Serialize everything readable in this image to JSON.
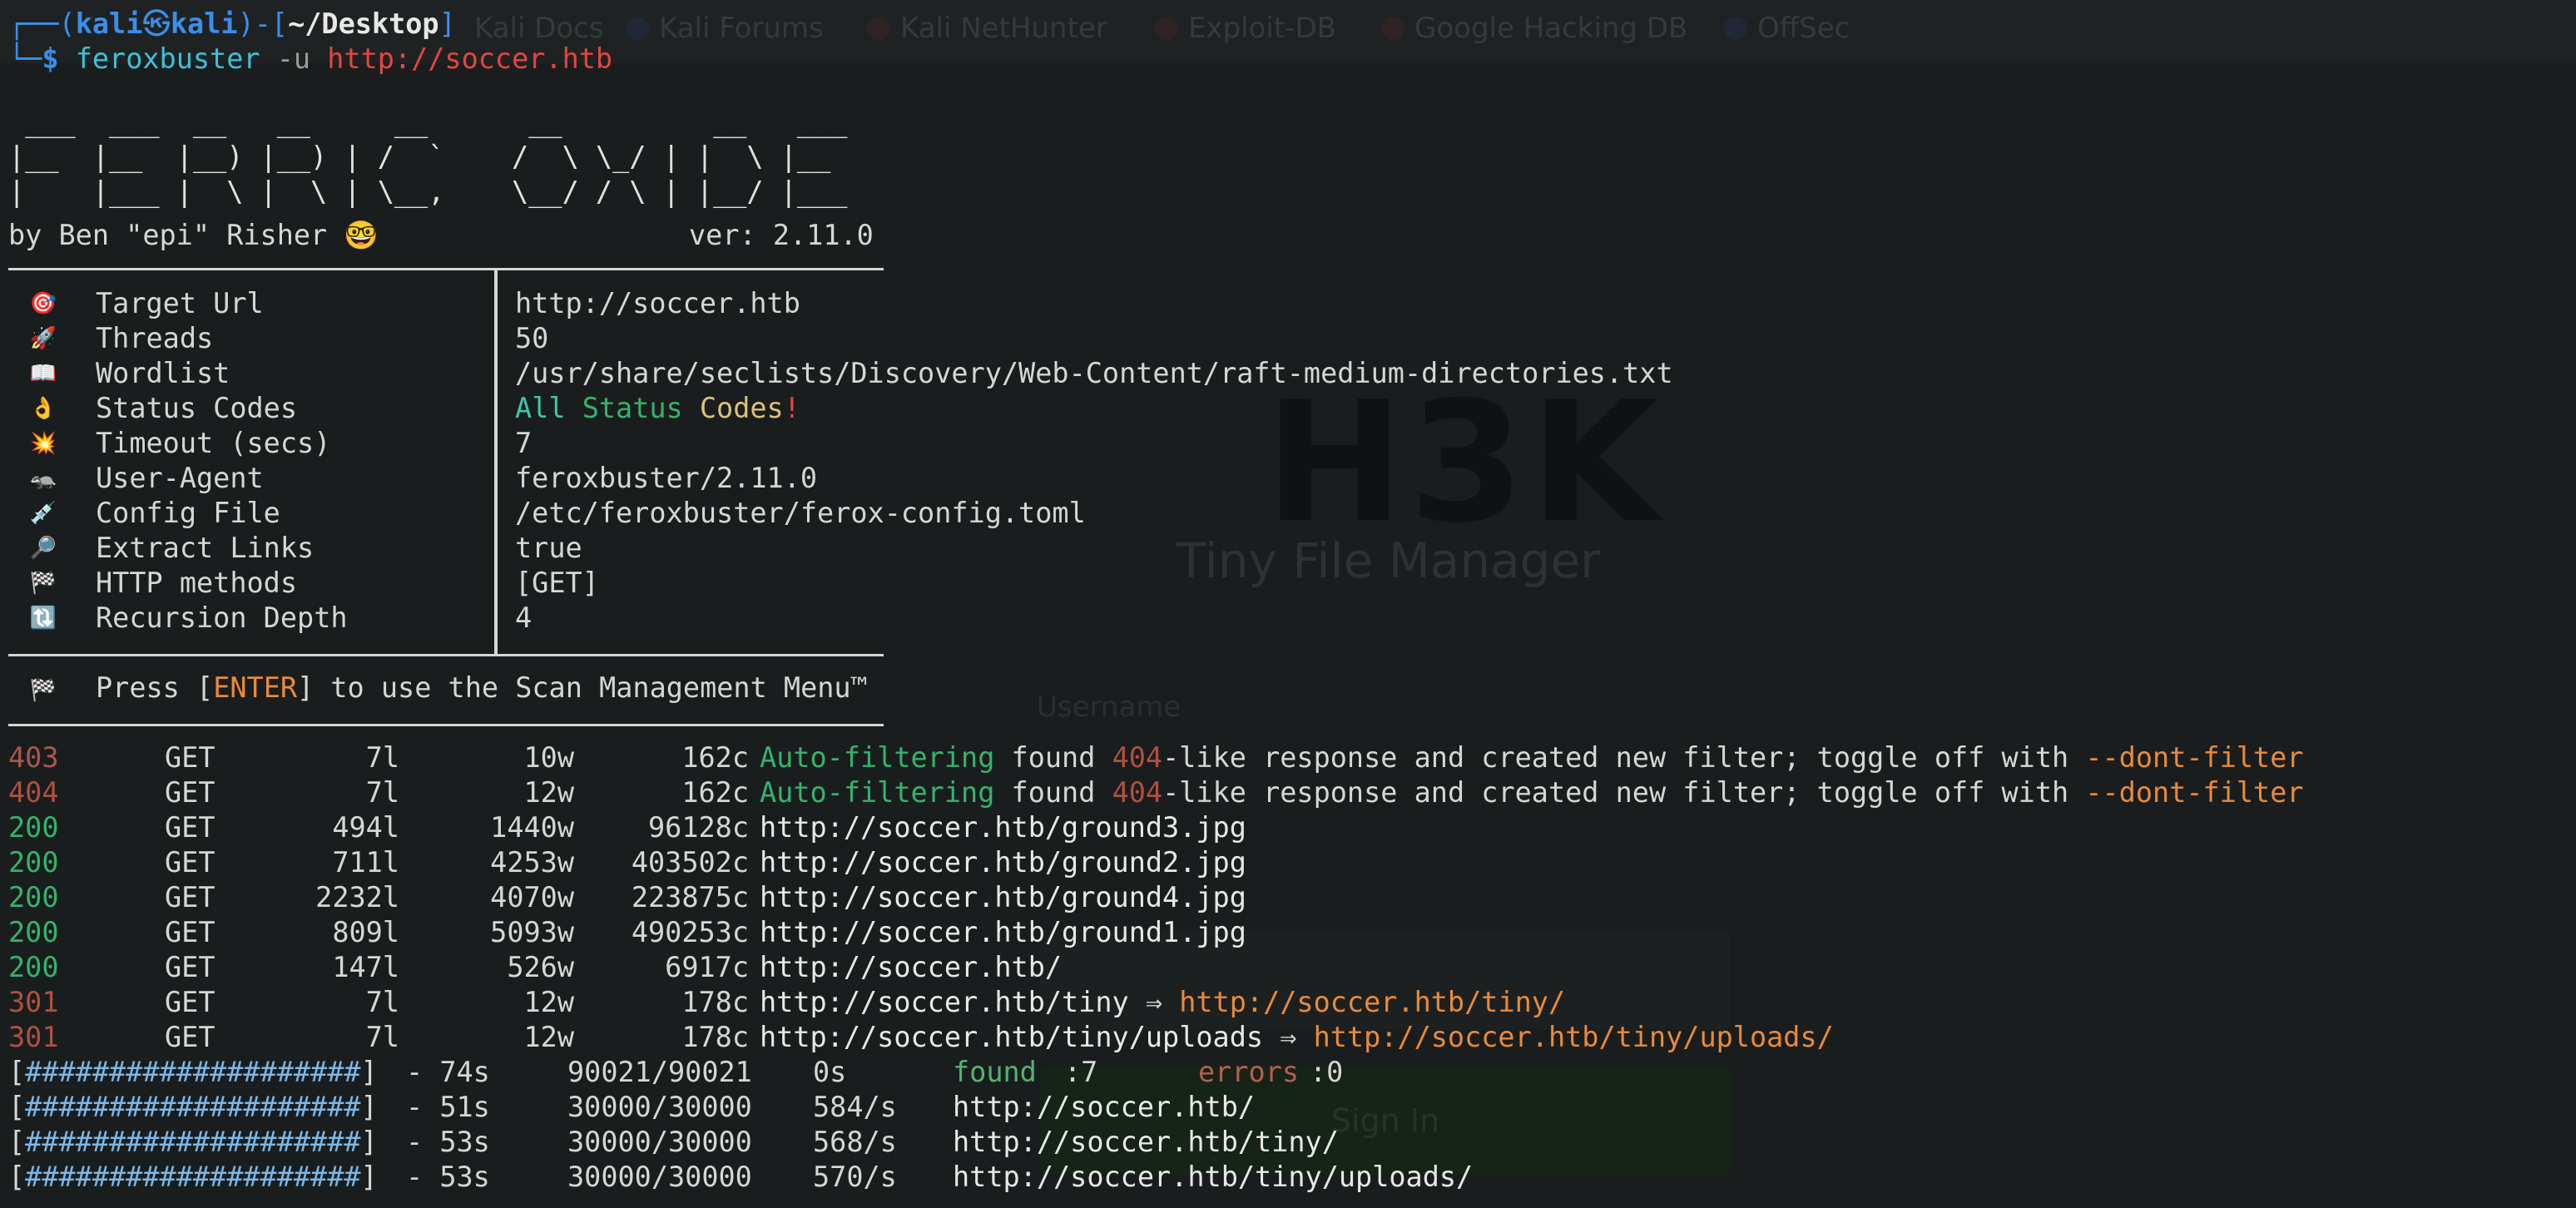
{
  "background": {
    "bookmarks": [
      {
        "label": "Kali Docs"
      },
      {
        "label": "Kali Forums"
      },
      {
        "label": "Kali NetHunter"
      },
      {
        "label": "Exploit-DB"
      },
      {
        "label": "Google Hacking DB"
      },
      {
        "label": "OffSec"
      }
    ],
    "page_logo": "H3K",
    "page_subtitle": "Tiny File Manager",
    "username_label": "Username",
    "sign_in_button": "Sign In"
  },
  "prompt": {
    "prefix_top": "┌──(",
    "user": "kali",
    "at": "㉿",
    "host": "kali",
    "mid": ")-[",
    "cwd": "~/Desktop",
    "close": "]",
    "prefix_bottom": "└─",
    "dollar": "$",
    "command": "feroxbuster",
    "flag": "-u",
    "url": "http://soccer.htb"
  },
  "banner": {
    "art": " ___  ___  __   __     __      __         __   ___\n|__  |__  |__) |__) | /  `    /  \\ \\_/ | |  \\ |__\n|    |___ |  \\ |  \\ | \\__,    \\__/ / \\ | |__/ |___",
    "author": "by Ben \"epi\" Risher 🤓",
    "version": "ver: 2.11.0"
  },
  "config": [
    {
      "icon": "🎯",
      "icon_name": "target-icon",
      "key": "Target Url",
      "value": "http://soccer.htb"
    },
    {
      "icon": "🚀",
      "icon_name": "rocket-icon",
      "key": "Threads",
      "value": "50"
    },
    {
      "icon": "📖",
      "icon_name": "book-icon",
      "key": "Wordlist",
      "value": "/usr/share/seclists/Discovery/Web-Content/raft-medium-directories.txt"
    },
    {
      "icon": "👌",
      "icon_name": "ok-hand-icon",
      "key": "Status Codes",
      "value_parts": [
        "All",
        "Status",
        "Codes",
        "!"
      ]
    },
    {
      "icon": "💥",
      "icon_name": "timeout-icon",
      "key": "Timeout (secs)",
      "value": "7"
    },
    {
      "icon": "🦡",
      "icon_name": "badger-icon",
      "key": "User-Agent",
      "value": "feroxbuster/2.11.0"
    },
    {
      "icon": "💉",
      "icon_name": "syringe-icon",
      "key": "Config File",
      "value": "/etc/feroxbuster/ferox-config.toml"
    },
    {
      "icon": "🔎",
      "icon_name": "magnifier-icon",
      "key": "Extract Links",
      "value": "true"
    },
    {
      "icon": "🏁",
      "icon_name": "checkered-flag-icon",
      "key": "HTTP methods",
      "value": "[GET]"
    },
    {
      "icon": "🔃",
      "icon_name": "recursion-icon",
      "key": "Recursion Depth",
      "value": "4"
    }
  ],
  "menu": {
    "icon": "🏁",
    "text_before": "Press [",
    "key": "ENTER",
    "text_after": "] to use the Scan Management Menu™"
  },
  "results": [
    {
      "status": "403",
      "method": "GET",
      "lines": "7l",
      "words": "10w",
      "chars": "162c",
      "auto": "Auto-filtering",
      "found": "found",
      "code": "404",
      "rest": "-like response and created new filter; toggle off with",
      "flag": "--dont-filter"
    },
    {
      "status": "404",
      "method": "GET",
      "lines": "7l",
      "words": "12w",
      "chars": "162c",
      "auto": "Auto-filtering",
      "found": "found",
      "code": "404",
      "rest": "-like response and created new filter; toggle off with",
      "flag": "--dont-filter"
    },
    {
      "status": "200",
      "method": "GET",
      "lines": "494l",
      "words": "1440w",
      "chars": "96128c",
      "url": "http://soccer.htb/ground3.jpg"
    },
    {
      "status": "200",
      "method": "GET",
      "lines": "711l",
      "words": "4253w",
      "chars": "403502c",
      "url": "http://soccer.htb/ground2.jpg"
    },
    {
      "status": "200",
      "method": "GET",
      "lines": "2232l",
      "words": "4070w",
      "chars": "223875c",
      "url": "http://soccer.htb/ground4.jpg"
    },
    {
      "status": "200",
      "method": "GET",
      "lines": "809l",
      "words": "5093w",
      "chars": "490253c",
      "url": "http://soccer.htb/ground1.jpg"
    },
    {
      "status": "200",
      "method": "GET",
      "lines": "147l",
      "words": "526w",
      "chars": "6917c",
      "url": "http://soccer.htb/"
    },
    {
      "status": "301",
      "method": "GET",
      "lines": "7l",
      "words": "12w",
      "chars": "178c",
      "url": "http://soccer.htb/tiny",
      "arrow": "⇒",
      "redirect": "http://soccer.htb/tiny/"
    },
    {
      "status": "301",
      "method": "GET",
      "lines": "7l",
      "words": "12w",
      "chars": "178c",
      "url": "http://soccer.htb/tiny/uploads",
      "arrow": "⇒",
      "redirect": "http://soccer.htb/tiny/uploads/"
    }
  ],
  "progress": [
    {
      "bar": "####################",
      "time": "- 74s",
      "count": "90021/90021",
      "rate": "0s",
      "found_label": "found",
      "found_value": ":7",
      "errors_label": "errors",
      "errors_value": ":0"
    },
    {
      "bar": "####################",
      "time": "- 51s",
      "count": "30000/30000",
      "rate": "584/s",
      "url": "http://soccer.htb/"
    },
    {
      "bar": "####################",
      "time": "- 53s",
      "count": "30000/30000",
      "rate": "568/s",
      "url": "http://soccer.htb/tiny/"
    },
    {
      "bar": "####################",
      "time": "- 53s",
      "count": "30000/30000",
      "rate": "570/s",
      "url": "http://soccer.htb/tiny/uploads/"
    }
  ],
  "colors": {
    "background": "#1a1d1e",
    "text": "#d6d6d6",
    "prompt_blue": "#3b8eea",
    "url_red": "#e5453d",
    "status_200": "#35b36b",
    "status_3xx": "#b05040",
    "redirect_orange": "#e98a3a"
  }
}
